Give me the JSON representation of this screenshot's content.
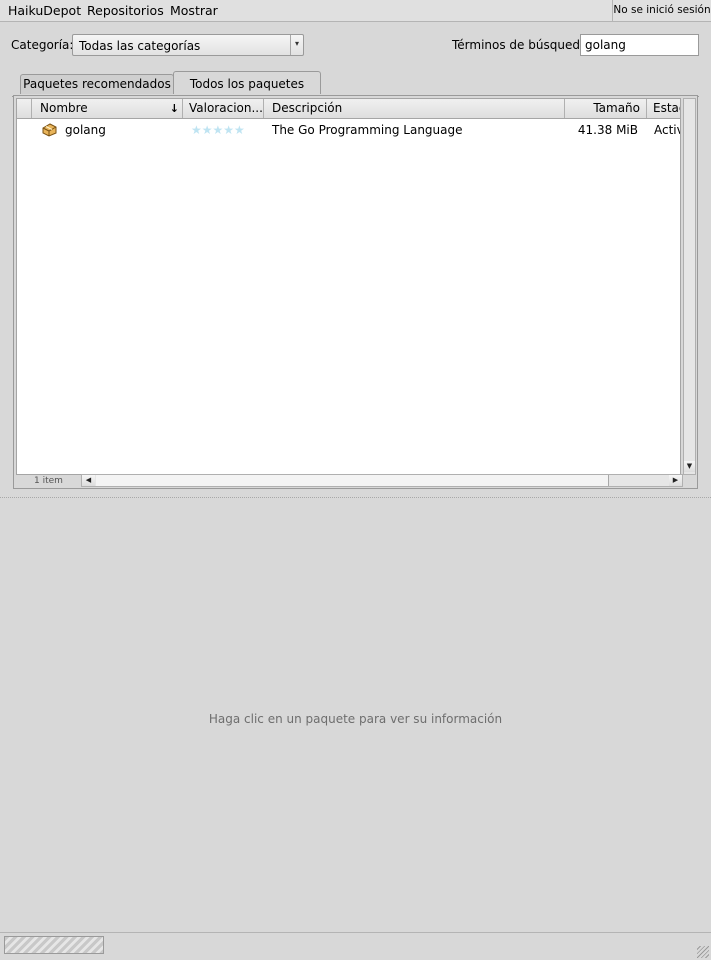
{
  "menubar": {
    "items": [
      "HaikuDepot",
      "Repositorios",
      "Mostrar"
    ],
    "login_status": "No se inició sesión"
  },
  "filters": {
    "category_label": "Categoría:",
    "category_value": "Todas las categorías",
    "search_label": "Términos de búsqueda",
    "search_value": "golang"
  },
  "tabs": [
    {
      "label": "Paquetes recomendados",
      "active": false
    },
    {
      "label": "Todos los paquetes",
      "active": true
    }
  ],
  "table": {
    "columns": [
      "Nombre",
      "Valoracion...",
      "Descripción",
      "Tamaño",
      "Estad"
    ],
    "sort_indicator": "sort-descending-icon",
    "rows": [
      {
        "icon": "package-icon",
        "name": "golang",
        "rating_stars": 5,
        "rating": "★★★★★",
        "description": "The Go Programming Language",
        "size": "41.38 MiB",
        "status": "Active"
      }
    ],
    "item_count": "1 item"
  },
  "detail": {
    "hint": "Haga clic en un paquete para ver su información"
  },
  "colors": {
    "background": "#d8d8d8",
    "rating_star": "#bfe4f2"
  }
}
